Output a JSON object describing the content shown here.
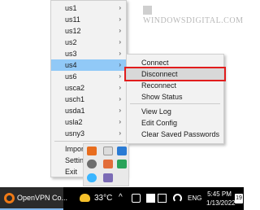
{
  "watermark": {
    "text": "WINDOWSDIGITAL.COM"
  },
  "menu": {
    "items": [
      {
        "label": "us1",
        "arrow": "›"
      },
      {
        "label": "us11",
        "arrow": "›"
      },
      {
        "label": "us12",
        "arrow": "›"
      },
      {
        "label": "us2",
        "arrow": "›"
      },
      {
        "label": "us3",
        "arrow": "›"
      },
      {
        "label": "us4",
        "arrow": "›",
        "highlighted": true
      },
      {
        "label": "us6",
        "arrow": "›"
      },
      {
        "label": "usca2",
        "arrow": "›"
      },
      {
        "label": "usch1",
        "arrow": "›"
      },
      {
        "label": "usda1",
        "arrow": "›"
      },
      {
        "label": "usla2",
        "arrow": "›"
      },
      {
        "label": "usny3",
        "arrow": "›"
      }
    ],
    "bottom_items": [
      {
        "label": "Import file..."
      },
      {
        "label": "Settings..."
      },
      {
        "label": "Exit"
      }
    ]
  },
  "submenu": {
    "items": [
      {
        "label": "Connect"
      },
      {
        "label": "Disconnect",
        "highlighted": true
      },
      {
        "label": "Reconnect"
      },
      {
        "label": "Show Status"
      },
      {
        "label": "View Log"
      },
      {
        "label": "Edit Config"
      },
      {
        "label": "Clear Saved Passwords"
      }
    ]
  },
  "taskbar": {
    "app_label": "OpenVPN Co...",
    "temperature": "33°C",
    "caret": "^",
    "language": "ENG",
    "time": "5:45 PM",
    "date": "1/13/2022",
    "notifications": "19"
  },
  "colors": {
    "menu_highlight": "#91c9f7",
    "callout_border": "#e11d1d",
    "taskbar_bg": "#000000"
  }
}
